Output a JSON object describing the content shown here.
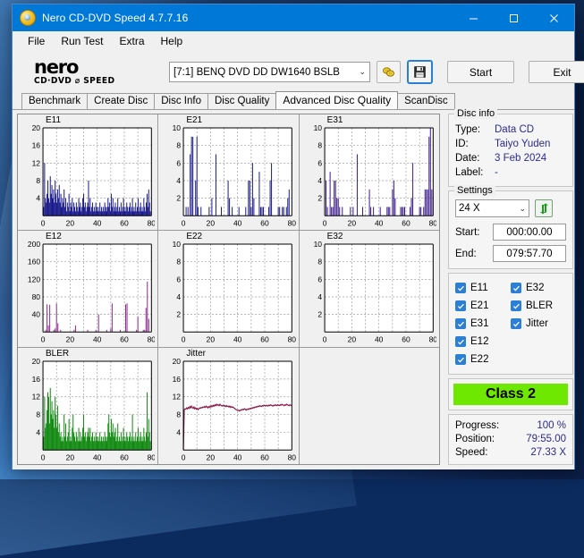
{
  "window": {
    "title": "Nero CD-DVD Speed 4.7.7.16",
    "icon": "nero-disc-icon",
    "minimize_label": "–",
    "maximize_label": "☐",
    "close_label": "✕"
  },
  "menu": {
    "items": [
      "File",
      "Run Test",
      "Extra",
      "Help"
    ]
  },
  "logo": {
    "name": "nero",
    "tagline": "CD·DVD ⌀ SPEED"
  },
  "toolbar": {
    "drive_value": "[7:1]   BENQ DVD DD DW1640 BSLB",
    "drive_caret": "⌄",
    "eject_icon": "disc-eject-icon",
    "save_icon": "floppy-save-icon",
    "start_label": "Start",
    "exit_label": "Exit"
  },
  "tabs": [
    {
      "label": "Benchmark",
      "active": false
    },
    {
      "label": "Create Disc",
      "active": false
    },
    {
      "label": "Disc Info",
      "active": false
    },
    {
      "label": "Disc Quality",
      "active": false
    },
    {
      "label": "Advanced Disc Quality",
      "active": true
    },
    {
      "label": "ScanDisc",
      "active": false
    }
  ],
  "disc_info": {
    "legend": "Disc info",
    "rows": [
      {
        "key": "Type:",
        "value": "Data CD"
      },
      {
        "key": "ID:",
        "value": "Taiyo Yuden"
      },
      {
        "key": "Date:",
        "value": "3 Feb 2024"
      },
      {
        "key": "Label:",
        "value": "-"
      }
    ]
  },
  "settings": {
    "legend": "Settings",
    "speed_value": "24 X",
    "speed_caret": "⌄",
    "refresh_icon": "refresh-arrows-icon",
    "start_label": "Start:",
    "start_value": "000:00.00",
    "end_label": "End:",
    "end_value": "079:57.70"
  },
  "checkboxes": {
    "left": [
      {
        "label": "E11",
        "checked": true
      },
      {
        "label": "E21",
        "checked": true
      },
      {
        "label": "E31",
        "checked": true
      },
      {
        "label": "E12",
        "checked": true
      },
      {
        "label": "E22",
        "checked": true
      }
    ],
    "right": [
      {
        "label": "E32",
        "checked": true
      },
      {
        "label": "BLER",
        "checked": true
      },
      {
        "label": "Jitter",
        "checked": true
      }
    ]
  },
  "quality": {
    "class_label": "Class 2",
    "class_color": "#6ee800"
  },
  "status": {
    "rows": [
      {
        "key": "Progress:",
        "value": "100 %"
      },
      {
        "key": "Position:",
        "value": "79:55.00"
      },
      {
        "key": "Speed:",
        "value": "27.33 X"
      }
    ]
  },
  "chart_data": [
    {
      "id": "E11",
      "type": "bar",
      "title": "E11",
      "color": "#1a1a8c",
      "xlabel": "",
      "ylabel": "",
      "xlim": [
        0,
        80
      ],
      "ylim": [
        0,
        20
      ],
      "xticks": [
        0,
        20,
        40,
        60,
        80
      ],
      "yticks": [
        4,
        8,
        12,
        16,
        20
      ],
      "grid": true,
      "x": [
        0.5,
        1.2,
        1.8,
        2.4,
        3,
        3.6,
        4.2,
        4.8,
        5.4,
        6,
        6.6,
        7.2,
        7.8,
        8.4,
        9,
        9.6,
        10.2,
        10.8,
        11.4,
        12,
        12.6,
        13.2,
        13.8,
        14.4,
        15,
        15.6,
        16.2,
        16.8,
        17.4,
        18,
        18.6,
        19.2,
        19.8,
        20.4,
        21,
        21.6,
        22.2,
        22.8,
        23.4,
        24,
        24.6,
        25.2,
        25.8,
        26.4,
        27,
        27.6,
        28.2,
        28.8,
        29.4,
        30,
        30.6,
        31.2,
        31.8,
        32.4,
        33,
        33.6,
        34.2,
        34.8,
        35.4,
        36,
        36.6,
        37.2,
        37.8,
        38.4,
        39,
        39.6,
        40.2,
        40.8,
        41.4,
        42,
        42.6,
        43.2,
        43.8,
        44.4,
        45,
        45.6,
        46.2,
        46.8,
        47.4,
        48,
        48.6,
        49.2,
        49.8,
        50.4,
        51,
        51.6,
        52.2,
        52.8,
        53.4,
        54,
        54.6,
        55.2,
        55.8,
        56.4,
        57,
        57.6,
        58.2,
        58.8,
        59.4,
        60,
        60.6,
        61.2,
        61.8,
        62.4,
        63,
        63.6,
        64.2,
        64.8,
        65.4,
        66,
        66.6,
        67.2,
        67.8,
        68.4,
        69,
        69.6,
        70.2,
        70.8,
        71.4,
        72,
        72.6,
        73.2,
        73.8,
        74.4,
        75,
        75.6,
        76.2,
        76.8,
        77.4,
        78,
        78.6,
        79.2
      ],
      "values": [
        2,
        12,
        4,
        3,
        5,
        8,
        4,
        3,
        9,
        5,
        7,
        4,
        6,
        3,
        8,
        5,
        3,
        6,
        4,
        7,
        3,
        5,
        2,
        4,
        3,
        6,
        2,
        4,
        1,
        3,
        2,
        5,
        1,
        3,
        2,
        4,
        1,
        3,
        2,
        1,
        3,
        2,
        1,
        4,
        2,
        3,
        1,
        2,
        4,
        5,
        2,
        3,
        1,
        2,
        3,
        8,
        2,
        4,
        1,
        2,
        3,
        1,
        2,
        1,
        3,
        2,
        1,
        2,
        1,
        3,
        1,
        2,
        1,
        2,
        1,
        3,
        2,
        1,
        2,
        4,
        2,
        3,
        1,
        5,
        2,
        4,
        1,
        2,
        3,
        1,
        2,
        4,
        1,
        2,
        1,
        3,
        1,
        2,
        4,
        1,
        2,
        1,
        3,
        2,
        1,
        2,
        3,
        1,
        2,
        4,
        1,
        2,
        1,
        3,
        1,
        2,
        4,
        1,
        2,
        3,
        1,
        2,
        1,
        4,
        2,
        1,
        3,
        5,
        2,
        6,
        3,
        1,
        2,
        1
      ]
    },
    {
      "id": "E21",
      "type": "bar",
      "title": "E21",
      "color": "#1a1a8c",
      "xlim": [
        0,
        80
      ],
      "ylim": [
        0,
        10
      ],
      "xticks": [
        0,
        20,
        40,
        60,
        80
      ],
      "yticks": [
        2,
        4,
        6,
        8,
        10
      ],
      "grid": true,
      "x": [
        2,
        3.4,
        5,
        6,
        7,
        9,
        10,
        10.8,
        13,
        19,
        21,
        24,
        28,
        33,
        34,
        36,
        41,
        46,
        48,
        49,
        50,
        51,
        52,
        56,
        57,
        58,
        59,
        63,
        64,
        65,
        70,
        71,
        73,
        74,
        76,
        77,
        78
      ],
      "values": [
        1,
        1,
        7,
        9,
        9,
        4,
        9,
        1,
        1,
        1,
        2,
        7,
        1,
        4,
        2,
        1,
        1,
        1,
        4,
        4,
        1,
        6,
        2,
        5,
        1,
        1,
        1,
        1,
        4,
        6,
        1,
        1,
        1,
        1,
        1,
        2,
        3
      ]
    },
    {
      "id": "E31",
      "type": "bar",
      "title": "E31",
      "color": "#3b1a8c",
      "xlim": [
        0,
        80
      ],
      "ylim": [
        0,
        10
      ],
      "xticks": [
        0,
        20,
        40,
        60,
        80
      ],
      "yticks": [
        2,
        4,
        6,
        8,
        10
      ],
      "grid": true,
      "x": [
        1,
        2,
        4,
        5,
        6,
        7,
        8,
        9,
        10,
        11,
        13,
        19,
        21,
        24,
        28,
        33,
        34,
        36,
        41,
        46,
        47,
        48,
        50,
        51,
        52,
        56,
        57,
        58,
        59,
        63,
        64,
        65,
        70,
        71,
        73,
        74,
        75,
        76,
        77,
        78,
        79
      ],
      "values": [
        4,
        1,
        5,
        1,
        1,
        4,
        4,
        2,
        2,
        1,
        1,
        1,
        1,
        7,
        1,
        3,
        1,
        1,
        1,
        1,
        1,
        1,
        3,
        4,
        2,
        1,
        1,
        1,
        1,
        1,
        2,
        6,
        1,
        1,
        1,
        3,
        3,
        3,
        9,
        10,
        3
      ]
    },
    {
      "id": "E12",
      "type": "bar",
      "title": "E12",
      "color": "#8e2a8e",
      "xlim": [
        0,
        80
      ],
      "ylim": [
        0,
        200
      ],
      "xticks": [
        0,
        20,
        40,
        60,
        80
      ],
      "yticks": [
        40,
        80,
        120,
        160,
        200
      ],
      "grid": true,
      "x": [
        2,
        3,
        4,
        5,
        8,
        9,
        10,
        11,
        13,
        23,
        24,
        33,
        39,
        41,
        47,
        50,
        51,
        57,
        61,
        62,
        69,
        70,
        74,
        75,
        76,
        77,
        78
      ],
      "values": [
        5,
        63,
        15,
        62,
        5,
        8,
        65,
        20,
        5,
        5,
        15,
        5,
        5,
        40,
        5,
        8,
        65,
        5,
        63,
        65,
        5,
        35,
        5,
        5,
        55,
        115,
        30
      ]
    },
    {
      "id": "E22",
      "type": "bar",
      "title": "E22",
      "color": "#1a1a8c",
      "xlim": [
        0,
        80
      ],
      "ylim": [
        0,
        10
      ],
      "xticks": [
        0,
        20,
        40,
        60,
        80
      ],
      "yticks": [
        2,
        4,
        6,
        8,
        10
      ],
      "grid": true,
      "x": [],
      "values": []
    },
    {
      "id": "E32",
      "type": "bar",
      "title": "E32",
      "color": "#3b1a8c",
      "xlim": [
        0,
        80
      ],
      "ylim": [
        0,
        10
      ],
      "xticks": [
        0,
        20,
        40,
        60,
        80
      ],
      "yticks": [
        2,
        4,
        6,
        8,
        10
      ],
      "grid": true,
      "x": [],
      "values": []
    },
    {
      "id": "BLER",
      "type": "bar",
      "title": "BLER",
      "color": "#128a12",
      "xlim": [
        0,
        80
      ],
      "ylim": [
        0,
        20
      ],
      "xticks": [
        0,
        20,
        40,
        60,
        80
      ],
      "yticks": [
        4,
        8,
        12,
        16,
        20
      ],
      "grid": true,
      "x": [
        0.5,
        1.2,
        1.8,
        2.4,
        3,
        3.6,
        4.2,
        4.8,
        5.4,
        6,
        6.6,
        7.2,
        7.8,
        8.4,
        9,
        9.6,
        10.2,
        10.8,
        11.4,
        12,
        12.6,
        13.2,
        13.8,
        14.4,
        15,
        15.6,
        16.2,
        16.8,
        17.4,
        18,
        18.6,
        19.2,
        19.8,
        20.4,
        21,
        21.6,
        22.2,
        22.8,
        23.4,
        24,
        24.6,
        25.2,
        25.8,
        26.4,
        27,
        27.6,
        28.2,
        28.8,
        29.4,
        30,
        30.6,
        31.2,
        31.8,
        32.4,
        33,
        33.6,
        34.2,
        34.8,
        35.4,
        36,
        36.6,
        37.2,
        37.8,
        38.4,
        39,
        39.6,
        40.2,
        40.8,
        41.4,
        42,
        42.6,
        43.2,
        43.8,
        44.4,
        45,
        45.6,
        46.2,
        46.8,
        47.4,
        48,
        48.6,
        49.2,
        49.8,
        50.4,
        51,
        51.6,
        52.2,
        52.8,
        53.4,
        54,
        54.6,
        55.2,
        55.8,
        56.4,
        57,
        57.6,
        58.2,
        58.8,
        59.4,
        60,
        60.6,
        61.2,
        61.8,
        62.4,
        63,
        63.6,
        64.2,
        64.8,
        65.4,
        66,
        66.6,
        67.2,
        67.8,
        68.4,
        69,
        69.6,
        70.2,
        70.8,
        71.4,
        72,
        72.6,
        73.2,
        73.8,
        74.4,
        75,
        75.6,
        76.2,
        76.8,
        77.4,
        78,
        78.6,
        79.2
      ],
      "values": [
        3,
        12,
        5,
        6,
        9,
        13,
        12,
        6,
        14,
        8,
        11,
        7,
        9,
        5,
        12,
        8,
        5,
        10,
        4,
        6,
        3,
        4,
        2,
        3,
        2,
        8,
        3,
        6,
        2,
        3,
        4,
        7,
        2,
        3,
        2,
        5,
        8,
        4,
        3,
        2,
        4,
        3,
        2,
        5,
        2,
        4,
        2,
        3,
        5,
        8,
        3,
        4,
        2,
        3,
        4,
        5,
        3,
        5,
        2,
        3,
        4,
        2,
        3,
        2,
        4,
        3,
        2,
        3,
        2,
        4,
        2,
        3,
        2,
        3,
        2,
        4,
        3,
        2,
        3,
        6,
        8,
        4,
        3,
        7,
        4,
        6,
        3,
        4,
        5,
        2,
        3,
        6,
        2,
        3,
        2,
        4,
        2,
        3,
        5,
        2,
        3,
        2,
        4,
        3,
        2,
        3,
        4,
        2,
        3,
        8,
        2,
        3,
        2,
        4,
        2,
        3,
        5,
        2,
        3,
        4,
        2,
        3,
        2,
        5,
        3,
        2,
        4,
        13,
        3,
        7,
        4,
        2,
        3,
        2
      ]
    },
    {
      "id": "Jitter",
      "type": "line",
      "title": "Jitter",
      "color": "#8c1a4a",
      "xlim": [
        0,
        80
      ],
      "ylim": [
        0,
        20
      ],
      "xticks": [
        0,
        20,
        40,
        60,
        80
      ],
      "yticks": [
        4,
        8,
        12,
        16,
        20
      ],
      "grid": true,
      "x": [
        0,
        0.6,
        1.2,
        1.8,
        2.4,
        3,
        3.6,
        4.2,
        4.8,
        5.4,
        6,
        6.6,
        7.2,
        7.8,
        8.4,
        9,
        9.6,
        10.2,
        10.8,
        11.4,
        12,
        12.6,
        13.2,
        13.8,
        14.4,
        15,
        15.6,
        16.2,
        16.8,
        17.4,
        18,
        18.6,
        19.2,
        19.8,
        20.4,
        21,
        21.6,
        22.2,
        22.8,
        23.4,
        24,
        24.6,
        25.2,
        25.8,
        26.4,
        27,
        27.6,
        28.2,
        28.8,
        29.4,
        30,
        30.6,
        31.2,
        31.8,
        32.4,
        33,
        33.6,
        34.2,
        34.8,
        35.4,
        36,
        36.6,
        37.2,
        37.8,
        38.4,
        39,
        39.6,
        40.2,
        40.8,
        41.4,
        42,
        42.6,
        43.2,
        43.8,
        44.4,
        45,
        45.6,
        46.2,
        46.8,
        47.4,
        48,
        48.6,
        49.2,
        49.8,
        50.4,
        51,
        51.6,
        52.2,
        52.8,
        53.4,
        54,
        54.6,
        55.2,
        55.8,
        56.4,
        57,
        57.6,
        58.2,
        58.8,
        59.4,
        60,
        60.6,
        61.2,
        61.8,
        62.4,
        63,
        63.6,
        64.2,
        64.8,
        65.4,
        66,
        66.6,
        67.2,
        67.8,
        68.4,
        69,
        69.6,
        70.2,
        70.8,
        71.4,
        72,
        72.6,
        73.2,
        73.8,
        74.4,
        75,
        75.6,
        76.2,
        76.8,
        77.4,
        78,
        78.6,
        79.2,
        79.8
      ],
      "values": [
        0,
        9.0,
        9.3,
        9.2,
        9.5,
        9.3,
        9.6,
        9.4,
        9.8,
        9.5,
        9.9,
        9.6,
        9.4,
        9.7,
        9.3,
        9.5,
        9.2,
        9.4,
        9.1,
        9.3,
        9.5,
        9.4,
        9.6,
        9.5,
        9.7,
        9.6,
        9.8,
        9.6,
        9.9,
        9.7,
        9.5,
        9.8,
        9.6,
        9.9,
        9.7,
        10.0,
        9.8,
        10.1,
        9.9,
        10.2,
        10.0,
        10.3,
        10.1,
        10.2,
        10.0,
        10.3,
        10.1,
        10.0,
        9.9,
        10.1,
        9.9,
        10.0,
        9.8,
        10.0,
        9.8,
        9.9,
        9.7,
        9.9,
        9.6,
        9.8,
        9.6,
        9.7,
        9.5,
        9.4,
        9.2,
        9.1,
        9.0,
        8.9,
        9.0,
        8.8,
        8.9,
        9.1,
        9.0,
        9.2,
        9.1,
        9.3,
        9.2,
        9.0,
        9.2,
        9.1,
        9.3,
        9.2,
        9.4,
        9.3,
        9.5,
        9.4,
        9.6,
        9.5,
        9.7,
        9.6,
        9.8,
        9.7,
        9.9,
        9.8,
        10.0,
        9.9,
        9.8,
        10.0,
        9.9,
        10.1,
        10.0,
        9.9,
        10.1,
        10.0,
        9.9,
        10.1,
        10.0,
        10.2,
        10.1,
        10.0,
        9.9,
        10.1,
        10.0,
        10.2,
        10.1,
        10.0,
        10.2,
        10.1,
        10.0,
        10.2,
        10.1,
        10.3,
        10.2,
        10.1,
        10.0,
        10.2,
        10.1,
        10.3,
        10.2,
        10.1,
        10.0,
        10.2,
        10.1,
        10.0
      ]
    }
  ]
}
